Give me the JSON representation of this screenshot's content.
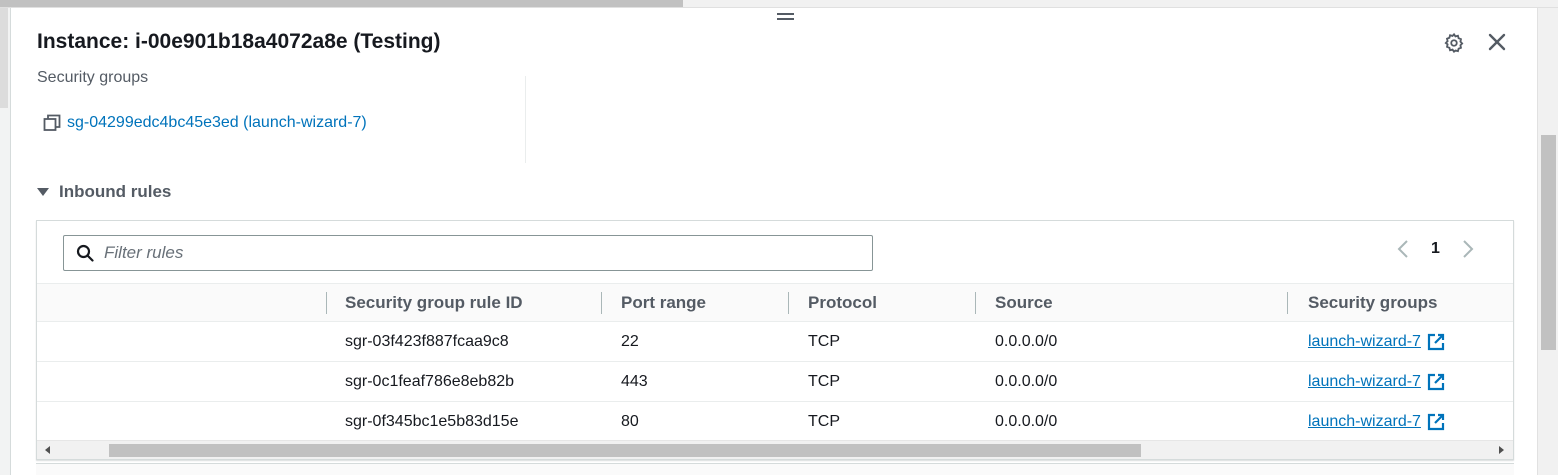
{
  "header": {
    "title": "Instance: i-00e901b18a4072a8e (Testing)",
    "settings_icon": "gear-icon",
    "close_icon": "close-icon"
  },
  "security": {
    "label": "Security groups",
    "group_link": "sg-04299edc4bc45e3ed (launch-wizard-7)",
    "copy_icon": "copy-icon"
  },
  "inbound": {
    "title": "Inbound rules",
    "filter_placeholder": "Filter rules",
    "page_number": "1",
    "columns": [
      "",
      "Security group rule ID",
      "Port range",
      "Protocol",
      "Source",
      "Security groups"
    ],
    "rows": [
      {
        "rule_id": "sgr-03f423f887fcaa9c8",
        "port": "22",
        "protocol": "TCP",
        "source": "0.0.0.0/0",
        "group": "launch-wizard-7"
      },
      {
        "rule_id": "sgr-0c1feaf786e8eb82b",
        "port": "443",
        "protocol": "TCP",
        "source": "0.0.0.0/0",
        "group": "launch-wizard-7"
      },
      {
        "rule_id": "sgr-0f345bc1e5b83d15e",
        "port": "80",
        "protocol": "TCP",
        "source": "0.0.0.0/0",
        "group": "launch-wizard-7"
      }
    ]
  },
  "colors": {
    "link": "#0073bb",
    "text": "#16191f",
    "secondary_text": "#545b64"
  }
}
